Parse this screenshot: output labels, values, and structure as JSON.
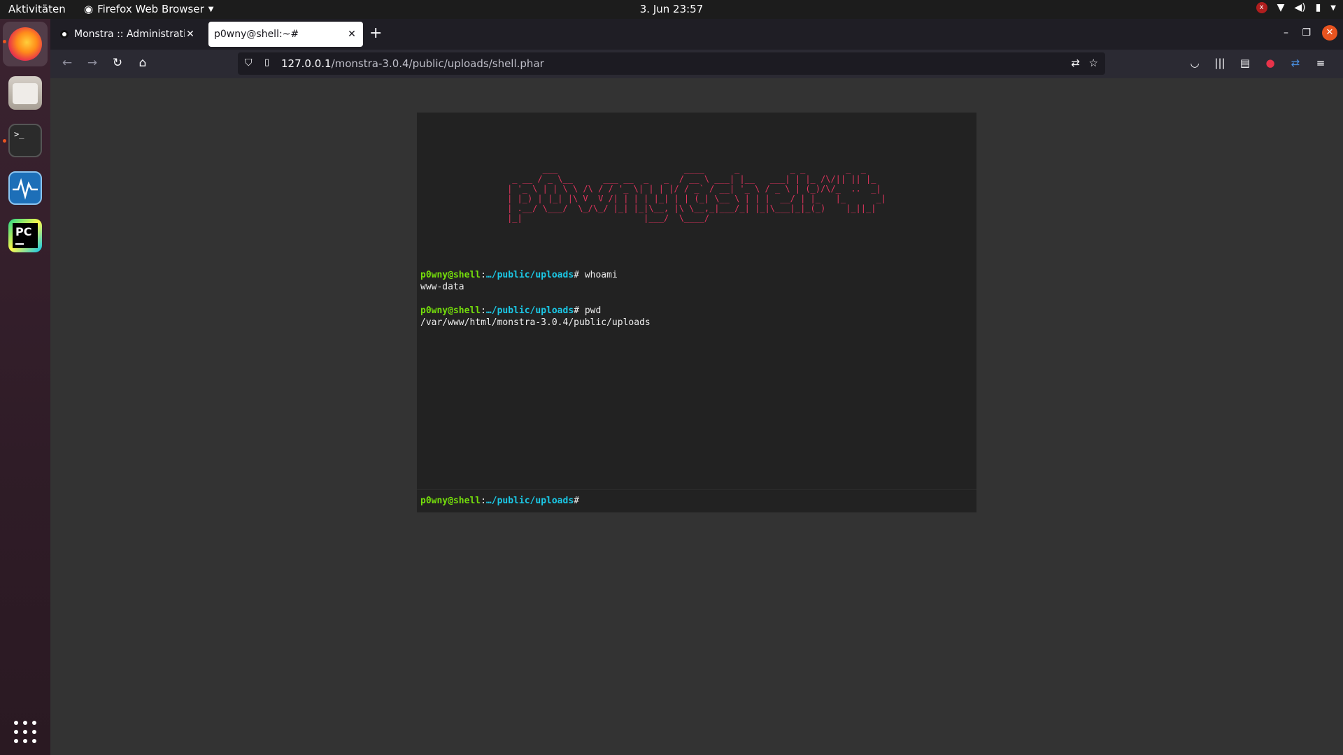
{
  "topbar": {
    "activities": "Aktivitäten",
    "app_menu": "Firefox Web Browser",
    "clock": "3. Jun  23:57"
  },
  "dock": {
    "items": [
      "firefox",
      "files",
      "terminal",
      "system-monitor",
      "pycharm"
    ],
    "grid_icon": "show-applications-icon"
  },
  "browser": {
    "tabs": [
      {
        "title": "Monstra :: Administration",
        "active": false
      },
      {
        "title": "p0wny@shell:~#",
        "active": true
      }
    ],
    "new_tab_label": "+",
    "url_host": "127.0.0.1",
    "url_path": "/monstra-3.0.4/public/uploads/shell.phar"
  },
  "shell": {
    "ascii_art": "                                                         \n       ___                         ____      _          _ _        _  _   \n _ __ / _ \\__      ___ __  _   _  / __ \\ ___| |__   ___| | |_ /\\/|| || |_ \n| '_ \\ | | \\ \\ /\\ / / '_ \\| | | |/ / _` / __| '_ \\ / _ \\ | (_)/\\/_  ..  _|\n| |_) | |_| |\\ V  V /| | | | |_| | | (_| \\__ \\ | | |  __/ | |_   |_      _|\n| .__/ \\___/  \\_/\\_/ |_| |_|\\__, |\\ \\__,_|___/_| |_|\\___|_|_(_)    |_||_|  \n|_|                        |___/  \\____/                                 \n",
    "output": [
      {
        "type": "cmd",
        "user": "p0wny@shell",
        "cwd": "…/public/uploads",
        "cmd": "whoami"
      },
      {
        "type": "text",
        "text": "www-data"
      },
      {
        "type": "blank"
      },
      {
        "type": "cmd",
        "user": "p0wny@shell",
        "cwd": "…/public/uploads",
        "cmd": "pwd"
      },
      {
        "type": "text",
        "text": "/var/www/html/monstra-3.0.4/public/uploads"
      }
    ],
    "prompt_user": "p0wny@shell",
    "prompt_cwd": "…/public/uploads",
    "input_value": ""
  },
  "colors": {
    "ascii": "#e3345e",
    "user": "#75df0b",
    "cwd": "#1bc9e7",
    "shell_bg": "#222222",
    "page_bg": "#333333"
  }
}
